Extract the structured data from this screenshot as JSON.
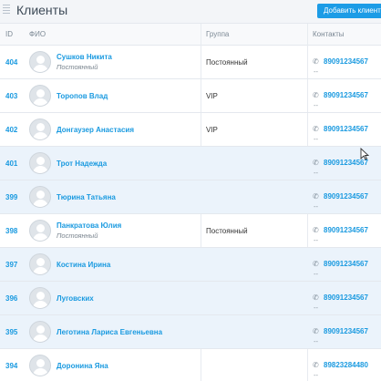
{
  "header": {
    "title": "Клиенты",
    "add_button": "Добавить клиента"
  },
  "columns": {
    "id": "ID",
    "name": "ФИО",
    "group": "Группа",
    "contacts": "Контакты"
  },
  "rows": [
    {
      "id": "404",
      "name": "Сушков Никита",
      "status": "Постоянный",
      "group": "Постоянный",
      "phone": "89091234567",
      "extra": "--"
    },
    {
      "id": "403",
      "name": "Торопов Влад",
      "status": "",
      "group": "VIP",
      "phone": "89091234567",
      "extra": "--"
    },
    {
      "id": "402",
      "name": "Донгаузер Анастасия",
      "status": "",
      "group": "VIP",
      "phone": "89091234567",
      "extra": "--"
    },
    {
      "id": "401",
      "name": "Трот Надежда",
      "status": "",
      "group": "",
      "phone": "89091234567",
      "extra": "--"
    },
    {
      "id": "399",
      "name": "Тюрина Татьяна",
      "status": "",
      "group": "",
      "phone": "89091234567",
      "extra": "--"
    },
    {
      "id": "398",
      "name": "Панкратова Юлия",
      "status": "Постоянный",
      "group": "Постоянный",
      "phone": "89091234567",
      "extra": "--"
    },
    {
      "id": "397",
      "name": "Костина Ирина",
      "status": "",
      "group": "",
      "phone": "89091234567",
      "extra": "--"
    },
    {
      "id": "396",
      "name": "Луговских",
      "status": "",
      "group": "",
      "phone": "89091234567",
      "extra": "--"
    },
    {
      "id": "395",
      "name": "Леготина Лариса Евгеньевна",
      "status": "",
      "group": "",
      "phone": "89091234567",
      "extra": "--"
    },
    {
      "id": "394",
      "name": "Доронина Яна",
      "status": "",
      "group": "",
      "phone": "89823284480",
      "extra": "--"
    }
  ],
  "icons": {
    "avatar": "user-avatar-icon",
    "phone": "phone-icon",
    "drag": "drag-handle-icon",
    "cursor": "mouse-cursor-icon"
  },
  "colors": {
    "accent": "#1a9ae0",
    "button": "#1c9ce6",
    "highlight_row": "#ebf3fb"
  }
}
